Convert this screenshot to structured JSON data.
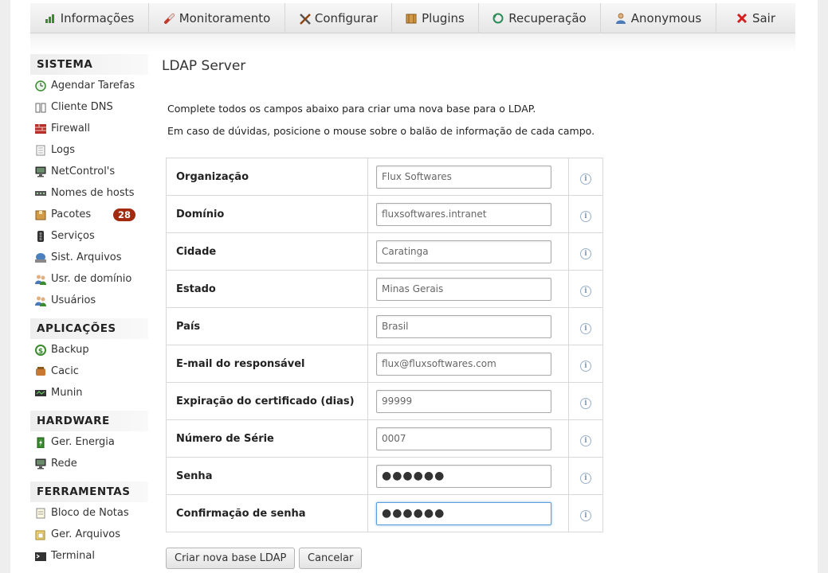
{
  "nav": [
    {
      "label": "Informações",
      "icon": "chart-icon"
    },
    {
      "label": "Monitoramento",
      "icon": "thermometer-icon"
    },
    {
      "label": "Configurar",
      "icon": "tools-icon"
    },
    {
      "label": "Plugins",
      "icon": "box-icon"
    },
    {
      "label": "Recuperação",
      "icon": "restore-icon"
    },
    {
      "label": "Anonymous",
      "icon": "user-icon"
    },
    {
      "label": "Sair",
      "icon": "close-icon"
    }
  ],
  "sidebar": {
    "sistema": {
      "title": "SISTEMA",
      "items": [
        {
          "label": "Agendar Tarefas",
          "icon": "schedule-icon"
        },
        {
          "label": "Cliente DNS",
          "icon": "book-icon"
        },
        {
          "label": "Firewall",
          "icon": "firewall-icon"
        },
        {
          "label": "Logs",
          "icon": "document-icon"
        },
        {
          "label": "NetControl's",
          "icon": "computer-icon"
        },
        {
          "label": "Nomes de hosts",
          "icon": "network-icon"
        },
        {
          "label": "Pacotes",
          "icon": "package-icon",
          "badge": "28"
        },
        {
          "label": "Serviços",
          "icon": "services-icon"
        },
        {
          "label": "Sist. Arquivos",
          "icon": "disk-icon"
        },
        {
          "label": "Usr. de domínio",
          "icon": "users-icon"
        },
        {
          "label": "Usuários",
          "icon": "users-icon"
        }
      ]
    },
    "aplicacoes": {
      "title": "APLICAÇÕES",
      "items": [
        {
          "label": "Backup",
          "icon": "backup-icon"
        },
        {
          "label": "Cacic",
          "icon": "cacic-icon"
        },
        {
          "label": "Munin",
          "icon": "monitor-icon"
        }
      ]
    },
    "hardware": {
      "title": "HARDWARE",
      "items": [
        {
          "label": "Ger. Energia",
          "icon": "battery-icon"
        },
        {
          "label": "Rede",
          "icon": "computer-icon"
        }
      ]
    },
    "ferramentas": {
      "title": "FERRAMENTAS",
      "items": [
        {
          "label": "Bloco de Notas",
          "icon": "notepad-icon"
        },
        {
          "label": "Ger. Arquivos",
          "icon": "folder-icon"
        },
        {
          "label": "Terminal",
          "icon": "terminal-icon"
        }
      ]
    }
  },
  "main": {
    "title": "LDAP Server",
    "intro1": "Complete todos os campos abaixo para criar uma nova base para o LDAP.",
    "intro2": "Em caso de dúvidas, posicione o mouse sobre o balão de informação de cada campo.",
    "fields": [
      {
        "label": "Organização",
        "placeholder": "Flux Softwares"
      },
      {
        "label": "Domínio",
        "placeholder": "fluxsoftwares.intranet"
      },
      {
        "label": "Cidade",
        "placeholder": "Caratinga"
      },
      {
        "label": "Estado",
        "placeholder": "Minas Gerais"
      },
      {
        "label": "País",
        "placeholder": "Brasil"
      },
      {
        "label": "E-mail do responsável",
        "placeholder": "flux@fluxsoftwares.com"
      },
      {
        "label": "Expiração do certificado (dias)",
        "placeholder": "99999"
      },
      {
        "label": "Número de Série",
        "placeholder": "0007"
      },
      {
        "label": "Senha",
        "value": "●●●●●●"
      },
      {
        "label": "Confirmação de senha",
        "value": "●●●●●●"
      }
    ],
    "info_glyph": "i",
    "create_button": "Criar nova base LDAP",
    "cancel_button": "Cancelar"
  },
  "colors": {
    "badge": "#a22a0e",
    "focus": "#5b9dd9",
    "info": "#7c98b8"
  }
}
